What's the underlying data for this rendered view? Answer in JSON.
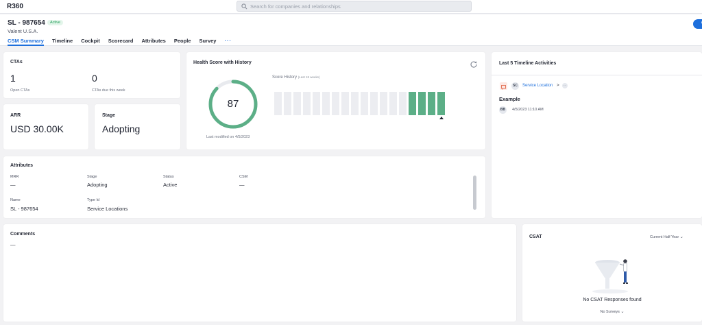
{
  "app": {
    "brand": "R360"
  },
  "search": {
    "placeholder": "Search for companies and relationships"
  },
  "account": {
    "name": "SL - 987654",
    "status_badge": "Active",
    "company": "Valent U.S.A.",
    "primary_button_label": "Co"
  },
  "tabs": [
    {
      "label": "CSM Summary",
      "active": true
    },
    {
      "label": "Timeline"
    },
    {
      "label": "Cockpit"
    },
    {
      "label": "Scorecard"
    },
    {
      "label": "Attributes"
    },
    {
      "label": "People"
    },
    {
      "label": "Survey"
    },
    {
      "label": "···"
    }
  ],
  "ctas": {
    "title": "CTAs",
    "open_value": "1",
    "open_label": "Open CTAs",
    "due_value": "0",
    "due_label": "CTAs due this week"
  },
  "arr": {
    "title": "ARR",
    "value": "USD 30.00K"
  },
  "stage_card": {
    "title": "Stage",
    "value": "Adopting"
  },
  "health": {
    "title": "Health Score with History",
    "score": "87",
    "score_fraction": 0.87,
    "ring_color": "#5caf87",
    "history_label": "Score History",
    "history_period": "(Last 18 weeks)",
    "history_filled": [
      false,
      false,
      false,
      false,
      false,
      false,
      false,
      false,
      false,
      false,
      false,
      false,
      false,
      false,
      true,
      true,
      true,
      true
    ],
    "last_modified": "Last modified on 4/5/2023",
    "refresh_icon": "refresh-icon"
  },
  "timeline": {
    "title": "Last 5 Timeline Activities",
    "entries": [
      {
        "type_initials": "SC",
        "link": "Service Location",
        "separator": ">",
        "title": "Example",
        "author_initials": "BB",
        "timestamp": "4/5/2023 11:10 AM"
      }
    ]
  },
  "attributes": {
    "title": "Attributes",
    "fields": [
      {
        "label": "MRR",
        "value": "—"
      },
      {
        "label": "Stage",
        "value": "Adopting"
      },
      {
        "label": "Status",
        "value": "Active"
      },
      {
        "label": "CSM",
        "value": "—"
      },
      {
        "label": "Name",
        "value": "SL - 987654"
      },
      {
        "label": "Type Id",
        "value": "Service Locations"
      }
    ]
  },
  "comments": {
    "title": "Comments",
    "value": "—"
  },
  "csat": {
    "title": "CSAT",
    "period": "Current Half Year",
    "empty_message": "No CSAT Responses found",
    "surveys_label": "No Surveys"
  },
  "colors": {
    "accent": "#1d6fdc",
    "success": "#5caf87"
  }
}
